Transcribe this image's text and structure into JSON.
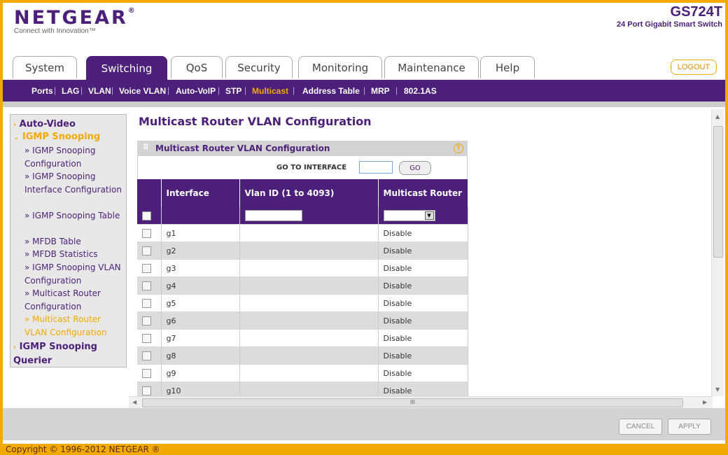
{
  "brand": {
    "logo": "NETGEAR",
    "tagline": "Connect with Innovation™",
    "model": "GS724T",
    "model_desc": "24 Port Gigabit Smart Switch"
  },
  "tabs": [
    "System",
    "Switching",
    "QoS",
    "Security",
    "Monitoring",
    "Maintenance",
    "Help"
  ],
  "active_tab": "Switching",
  "logout_label": "LOGOUT",
  "subnav": [
    "Ports",
    "LAG",
    "VLAN",
    "Voice VLAN",
    "Auto-VoIP",
    "STP",
    "Multicast",
    "Address Table",
    "MRP",
    "802.1AS"
  ],
  "active_subnav": "Multicast",
  "leftmenu": {
    "g1": "Auto-Video",
    "g2": "IGMP Snooping",
    "items": [
      "» IGMP Snooping Configuration",
      "» IGMP Snooping Interface Configuration",
      "» IGMP Snooping Table",
      "» MFDB Table",
      "» MFDB Statistics",
      "» IGMP Snooping VLAN Configuration",
      "» Multicast Router Configuration",
      "» Multicast Router VLAN Configuration"
    ],
    "g3": "IGMP Snooping Querier"
  },
  "page_title": "Multicast Router VLAN Configuration",
  "panel_title": "Multicast Router VLAN Configuration",
  "goto_label": "GO TO INTERFACE",
  "go_label": "GO",
  "columns": {
    "interface": "Interface",
    "vlan": "Vlan ID (1 to 4093)",
    "mrouter": "Multicast Router"
  },
  "rows": [
    {
      "iface": "g1",
      "mode": "Disable"
    },
    {
      "iface": "g2",
      "mode": "Disable"
    },
    {
      "iface": "g3",
      "mode": "Disable"
    },
    {
      "iface": "g4",
      "mode": "Disable"
    },
    {
      "iface": "g5",
      "mode": "Disable"
    },
    {
      "iface": "g6",
      "mode": "Disable"
    },
    {
      "iface": "g7",
      "mode": "Disable"
    },
    {
      "iface": "g8",
      "mode": "Disable"
    },
    {
      "iface": "g9",
      "mode": "Disable"
    },
    {
      "iface": "g10",
      "mode": "Disable"
    }
  ],
  "hscroll_label": "III",
  "cancel_label": "CANCEL",
  "apply_label": "APPLY",
  "copyright": "Copyright © 1996-2012 NETGEAR ®"
}
